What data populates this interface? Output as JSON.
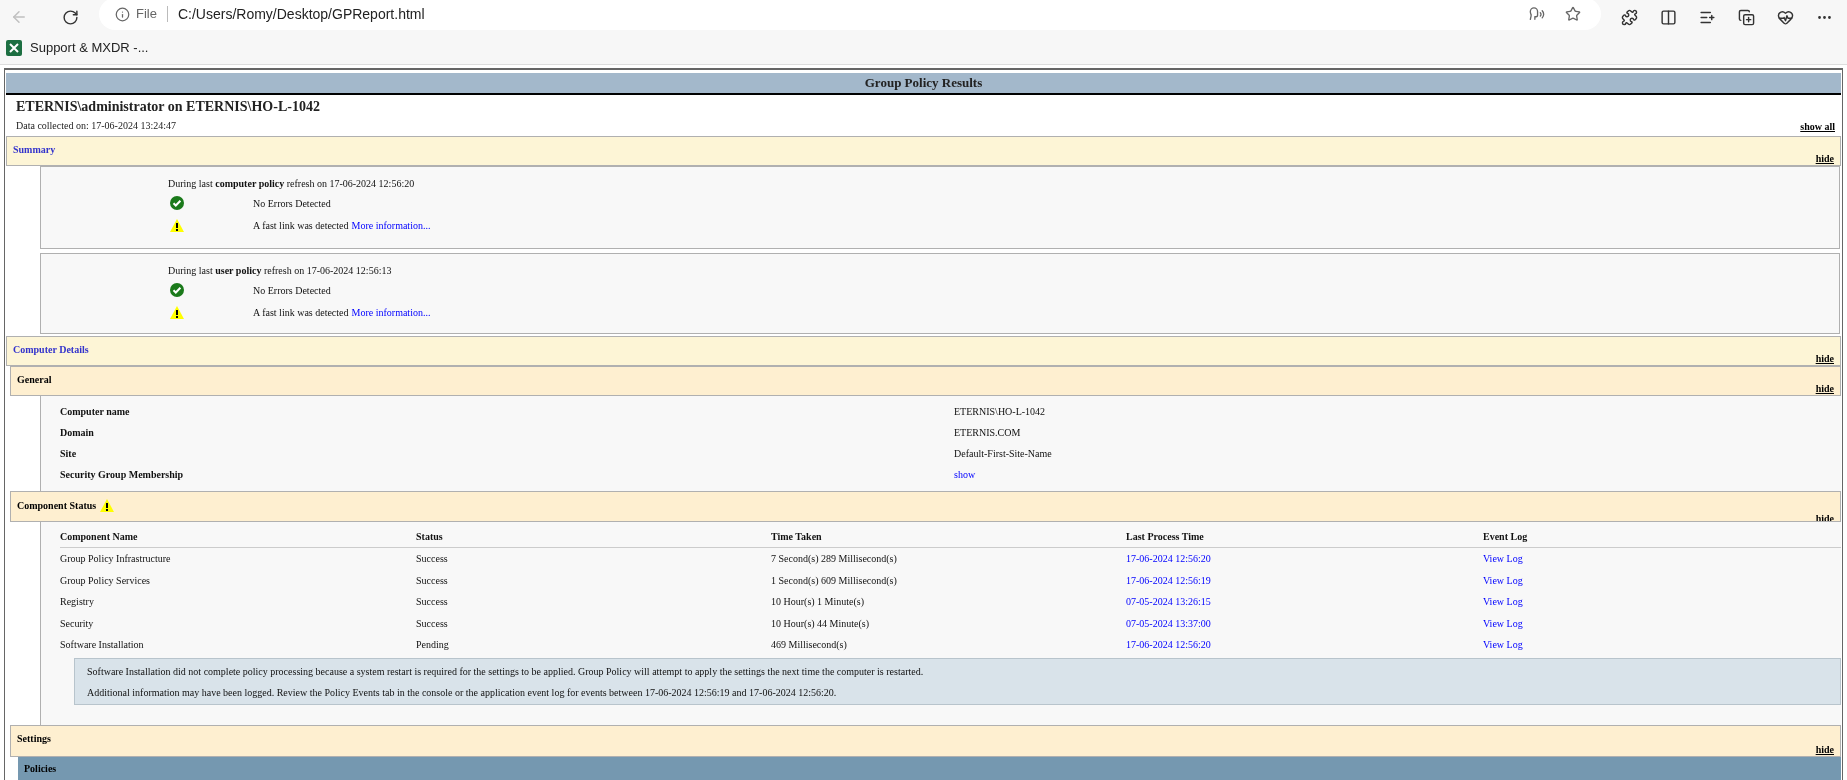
{
  "browser": {
    "scheme_label": "File",
    "url": "C:/Users/Romy/Desktop/GPReport.html",
    "bookmarks": [
      {
        "label": "Support & MXDR -..."
      }
    ]
  },
  "report": {
    "title": "Group Policy Results",
    "heading": "ETERNIS\\administrator on ETERNIS\\HO-L-1042",
    "collected": "Data collected on: 17-06-2024 13:24:47",
    "show_all": "show all",
    "summary": {
      "title": "Summary",
      "toggle": "hide",
      "refreshes": [
        {
          "text": "During last **computer policy** refresh on 17-06-2024 12:56:20",
          "entries": [
            {
              "kind": "ok",
              "text": "No Errors Detected"
            },
            {
              "kind": "warning",
              "text": "A fast link was detected",
              "link": "More information..."
            }
          ]
        },
        {
          "text": "During last **user policy** refresh on 17-06-2024 12:56:13",
          "entries": [
            {
              "kind": "ok",
              "text": "No Errors Detected"
            },
            {
              "kind": "warning",
              "text": "A fast link was detected",
              "link": "More information..."
            }
          ]
        }
      ]
    },
    "computer_details": {
      "title": "Computer Details",
      "toggle": "hide",
      "general": {
        "title": "General",
        "toggle": "hide",
        "rows": [
          {
            "label": "Computer name",
            "value": "ETERNIS\\HO-L-1042",
            "kind": "text"
          },
          {
            "label": "Domain",
            "value": "ETERNIS.COM",
            "kind": "text"
          },
          {
            "label": "Site",
            "value": "Default-First-Site-Name",
            "kind": "text"
          },
          {
            "label": "Security Group Membership",
            "value": "show",
            "kind": "link"
          }
        ]
      },
      "component_status": {
        "title": "Component Status",
        "warning": true,
        "toggle": "hide",
        "columns": [
          "Component Name",
          "Status",
          "Time Taken",
          "Last Process Time",
          "Event Log"
        ],
        "rows": [
          [
            "Group Policy Infrastructure",
            "Success",
            "7 Second(s) 289 Millisecond(s)",
            "17-06-2024 12:56:20",
            "View Log"
          ],
          [
            "Group Policy Services",
            "Success",
            "1 Second(s) 609 Millisecond(s)",
            "17-06-2024 12:56:19",
            "View Log"
          ],
          [
            "Registry",
            "Success",
            "10 Hour(s) 1 Minute(s)",
            "07-05-2024 13:26:15",
            "View Log"
          ],
          [
            "Security",
            "Success",
            "10 Hour(s) 44 Minute(s)",
            "07-05-2024 13:37:00",
            "View Log"
          ],
          [
            "Software Installation",
            "Pending",
            "469 Millisecond(s)",
            "17-06-2024 12:56:20",
            "View Log"
          ]
        ],
        "note": [
          "Software Installation did not complete policy processing because a system restart is required for the settings to be applied. Group Policy will attempt to apply the settings the next time the computer is restarted.",
          "Additional information may have been logged. Review the Policy Events tab in the console or the application event log for events between 17-06-2024 12:56:19 and 17-06-2024 12:56:20."
        ]
      }
    },
    "settings": {
      "title": "Settings",
      "toggle": "hide",
      "policies": {
        "title": "Policies"
      }
    }
  }
}
